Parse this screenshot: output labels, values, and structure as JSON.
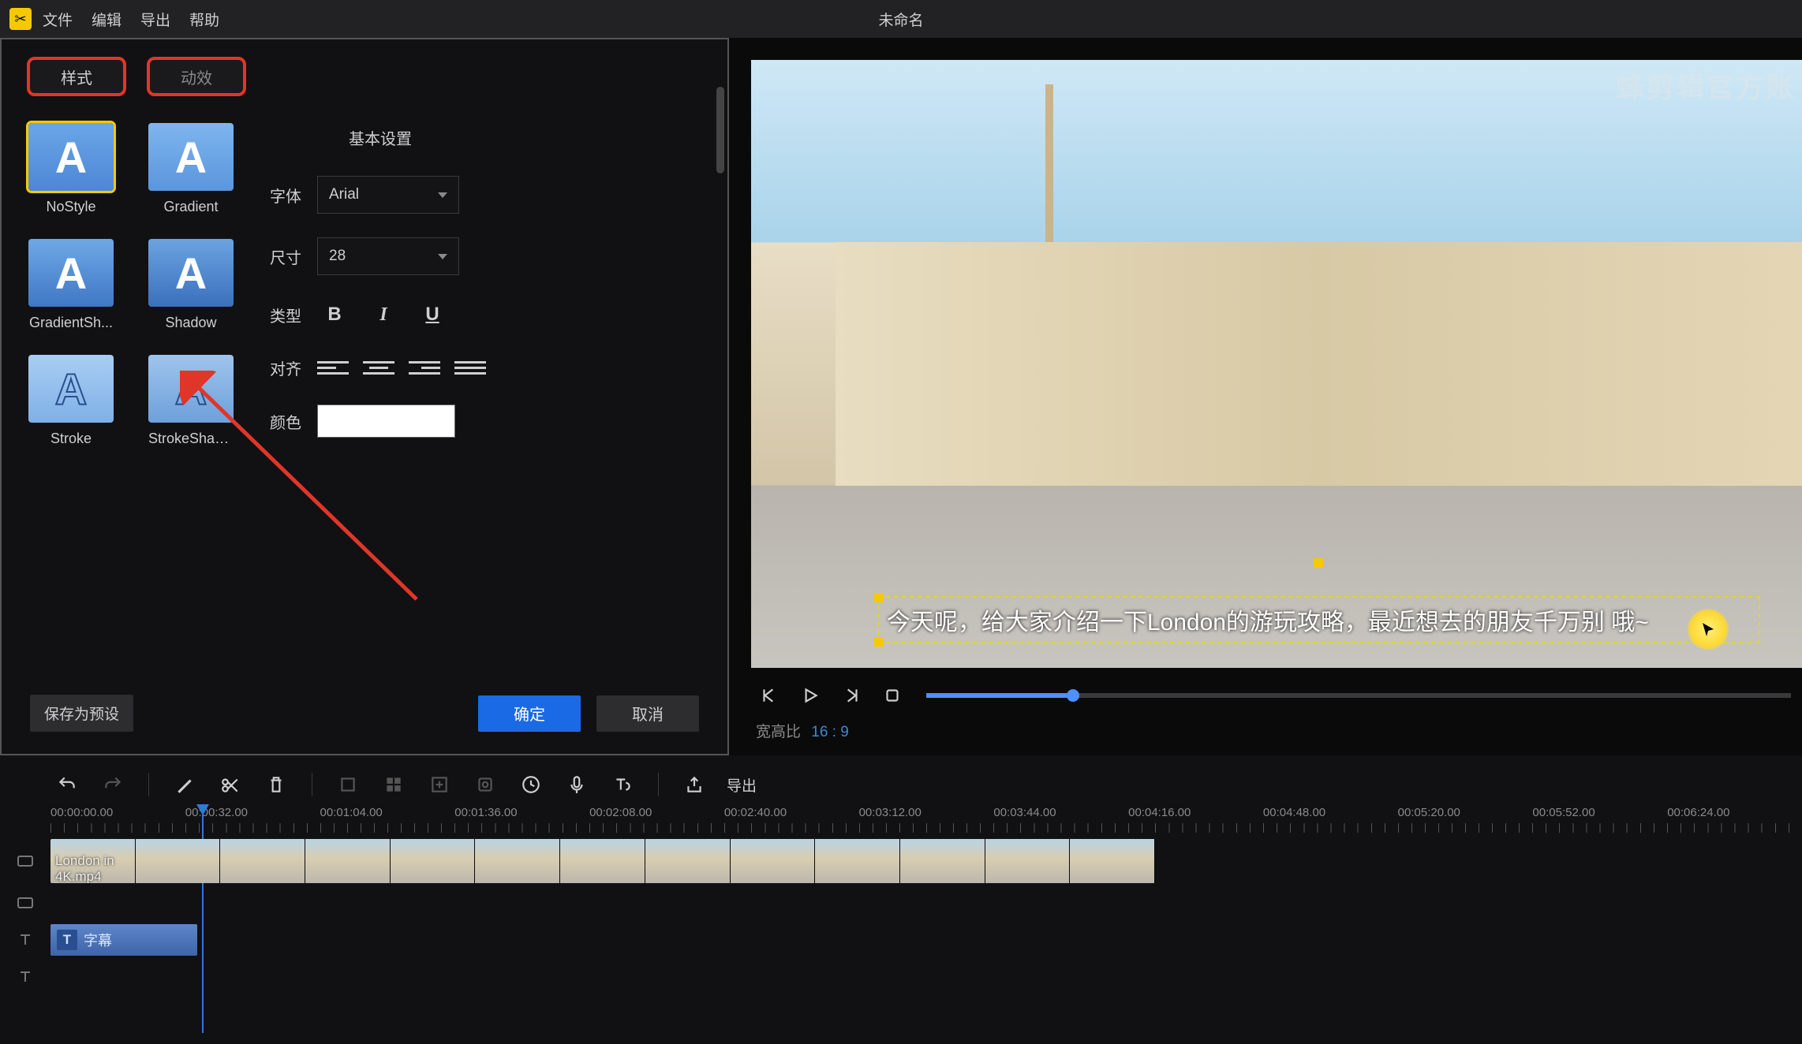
{
  "menubar": {
    "items": [
      "文件",
      "编辑",
      "导出",
      "帮助"
    ],
    "title": "未命名"
  },
  "tabs": {
    "style": "样式",
    "effect": "动效"
  },
  "presets": [
    {
      "name": "NoStyle",
      "cls": "t-nostyle",
      "selected": true
    },
    {
      "name": "Gradient",
      "cls": "t-gradient",
      "selected": false
    },
    {
      "name": "GradientSh...",
      "cls": "t-gradientsh",
      "selected": false
    },
    {
      "name": "Shadow",
      "cls": "t-shadow",
      "selected": false
    },
    {
      "name": "Stroke",
      "cls": "t-stroke",
      "selected": false
    },
    {
      "name": "StrokeShad...",
      "cls": "t-strokesh",
      "selected": false
    }
  ],
  "form": {
    "section": "基本设置",
    "font_label": "字体",
    "font_value": "Arial",
    "size_label": "尺寸",
    "size_value": "28",
    "type_label": "类型",
    "align_label": "对齐",
    "color_label": "颜色",
    "color_value": "#ffffff"
  },
  "buttons": {
    "save_preset": "保存为预设",
    "ok": "确定",
    "cancel": "取消"
  },
  "preview": {
    "watermark": "蜂剪辑官方账",
    "subtitle": "今天呢，给大家介绍一下London的游玩攻略，最近想去的朋友千万别      哦~",
    "aspect_label": "宽高比",
    "aspect_value": "16 : 9"
  },
  "timeline": {
    "export": "导出",
    "ticks": [
      "00:00:00.00",
      "00:00:32.00",
      "00:01:04.00",
      "00:01:36.00",
      "00:02:08.00",
      "00:02:40.00",
      "00:03:12.00",
      "00:03:44.00",
      "00:04:16.00",
      "00:04:48.00",
      "00:05:20.00",
      "00:05:52.00",
      "00:06:24.00"
    ],
    "video_clip": "London in 4K.mp4",
    "sub_clip": "字幕"
  }
}
